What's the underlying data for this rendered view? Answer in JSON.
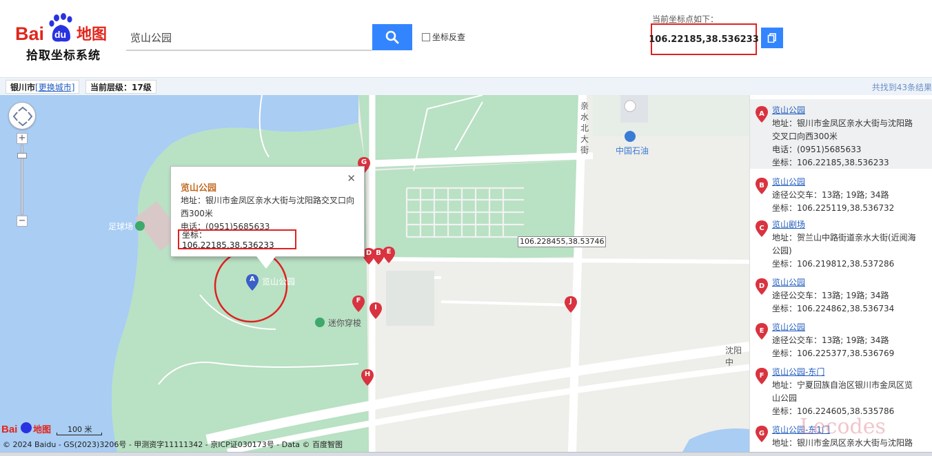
{
  "header": {
    "logo_brand": "Bai du 地图",
    "subtitle": "拾取坐标系统",
    "search_value": "览山公园",
    "reverse_label": "坐标反查",
    "coord_label": "当前坐标点如下：",
    "current_coord": "106.22185,38.536233"
  },
  "toolbar": {
    "city": "银川市",
    "change_city": "[更换城市]",
    "level_label": "当前层级：",
    "level_value": "17级",
    "found_text": "共找到43条结果"
  },
  "map": {
    "popup": {
      "title": "览山公园",
      "address": "地址：银川市金凤区亲水大街与沈阳路交叉口向西300米",
      "tel": "电话：(0951)5685633",
      "coord": "坐标：106.22185,38.536233"
    },
    "hover_coord": "106.228455,38.53746",
    "road_label_v": "亲水北大街",
    "road_label_h": "沈阳中",
    "poi_gas": "中国石油",
    "poi_maze": "迷你穿梭",
    "poi_park": "览山公园",
    "poi_football": "足球场",
    "scale": "100 米",
    "copyright": "© 2024 Baidu - GS(2023)3206号 - 甲测资字11111342 - 京ICP证030173号 - Data © 百度智图",
    "markers": [
      "A",
      "B",
      "C",
      "D",
      "E",
      "F",
      "G",
      "H",
      "I",
      "J"
    ],
    "marker_color": "#d9333f"
  },
  "results": [
    {
      "letter": "A",
      "name": "览山公园",
      "lines": [
        "地址：银川市金凤区亲水大街与沈阳路",
        "交叉口向西300米",
        "电话：(0951)5685633",
        "坐标：106.22185,38.536233"
      ]
    },
    {
      "letter": "B",
      "name": "览山公园",
      "lines": [
        "途径公交车：13路; 19路; 34路",
        "坐标：106.225119,38.536732"
      ]
    },
    {
      "letter": "C",
      "name": "览山剧场",
      "lines": [
        "地址：贺兰山中路街道亲水大街(近阅海",
        "公园)",
        "坐标：106.219812,38.537286"
      ]
    },
    {
      "letter": "D",
      "name": "览山公园",
      "lines": [
        "途径公交车：13路; 19路; 34路",
        "坐标：106.224862,38.536734"
      ]
    },
    {
      "letter": "E",
      "name": "览山公园",
      "lines": [
        "途径公交车：13路; 19路; 34路",
        "坐标：106.225377,38.536769"
      ]
    },
    {
      "letter": "F",
      "name": "览山公园-东门",
      "lines": [
        "地址：宁夏回族自治区银川市金凤区览",
        "山公园",
        "坐标：106.224605,38.535786"
      ]
    },
    {
      "letter": "G",
      "name": "览山公园-东1门",
      "lines": [
        "地址：银川市金凤区亲水大街与沈阳路"
      ]
    }
  ],
  "watermark": "Lecodes",
  "colors": {
    "accent": "#3385ff",
    "highlight": "#e02020",
    "link": "#1f5bbf",
    "popup_title": "#c06b22"
  }
}
